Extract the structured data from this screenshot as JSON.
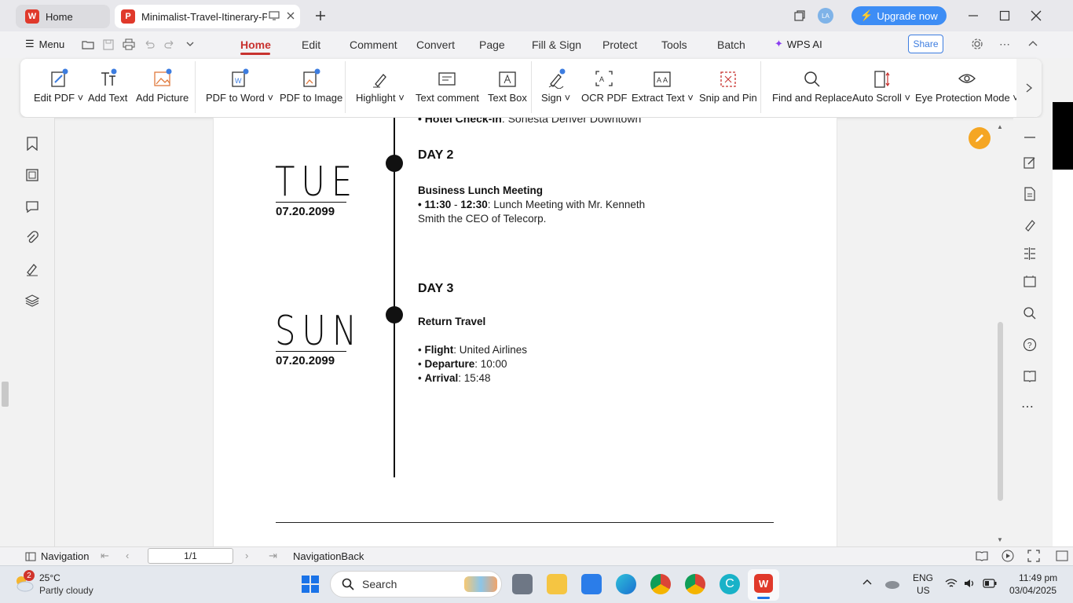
{
  "titlebar": {
    "home_tab": "Home",
    "doc_tab": "Minimalist-Travel-Itinerary-Pla",
    "avatar": "LA",
    "upgrade": "Upgrade now"
  },
  "menubar": {
    "menu": "Menu",
    "tabs": [
      "Home",
      "Edit",
      "Comment",
      "Convert",
      "Page",
      "Fill & Sign",
      "Protect",
      "Tools",
      "Batch"
    ],
    "ai": "WPS AI",
    "share": "Share"
  },
  "ribbon": {
    "tools": [
      "Edit PDF",
      "Add Text",
      "Add Picture",
      "PDF to Word",
      "PDF to Image",
      "Highlight",
      "Text comment",
      "Text Box",
      "Sign",
      "OCR PDF",
      "Extract Text",
      "Snip and Pin",
      "Find and Replace",
      "Auto Scroll",
      "Eye Protection Mode"
    ]
  },
  "document": {
    "top_line_bold": "• Hotel Check-in",
    "top_line_rest": ": Sonesta Denver Downtown",
    "day2": {
      "weekday": "TUE",
      "date": "07.20.2099",
      "heading": "DAY 2",
      "event_title": "Business Lunch Meeting",
      "line1_bold_a": "• 11:30",
      "line1_dash": " - ",
      "line1_bold_b": "12:30",
      "line1_rest": ": Lunch Meeting with Mr. Kenneth",
      "line2": "Smith the CEO of Telecorp."
    },
    "day3": {
      "weekday": "SUN",
      "date": "07.20.2099",
      "heading": "DAY 3",
      "event_title": "Return Travel",
      "flight_label": "Flight",
      "flight_value": ": United Airlines",
      "departure_label": "Departure",
      "departure_value": ": 10:00",
      "arrival_label": "Arrival",
      "arrival_value": ": 15:48"
    }
  },
  "statusbar": {
    "navigation": "Navigation",
    "page": "1/1",
    "nav_back": "NavigationBack"
  },
  "taskbar": {
    "weather_badge": "2",
    "temperature": "25°C",
    "condition": "Partly cloudy",
    "search": "Search",
    "lang": "ENG",
    "region": "US",
    "time": "11:49 pm",
    "date": "03/04/2025"
  },
  "colors": {
    "accent": "#c8322f",
    "upgrade": "#3d8df5",
    "pen_fab": "#f5a623"
  }
}
